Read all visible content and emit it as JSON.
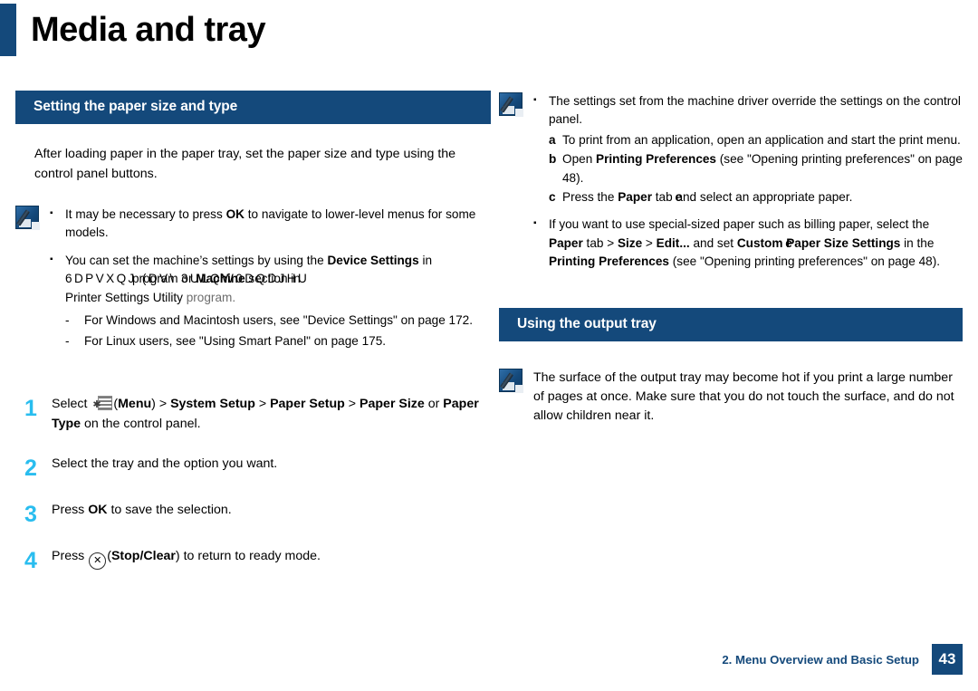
{
  "page": {
    "title": "Media and tray",
    "accent_color": "#14497b",
    "step_number_color": "#29bdef"
  },
  "left": {
    "section_title": "Setting the paper size and type",
    "intro": "After loading paper in the paper tray, set the paper size and type using the control panel buttons.",
    "note": {
      "icon": "note-pencil-icon",
      "bullets": [
        {
          "pre": "It may be necessary to press ",
          "bold": "OK",
          "post": " to navigate to lower-level menus for some models."
        },
        {
          "pre": "You can set the machine’s settings by using the ",
          "bold": "Device Settings",
          "post": " in ",
          "overlap_back": "6DPVXQJ (DV\\ 3ULQW0DQDJHU",
          "overlap_front_1": "program or ",
          "overlap_front_bold": "Machine",
          "overlap_front_2": " section in",
          "tail_pre": "Printer Settings Utility ",
          "tail_grey": "program."
        }
      ],
      "dash_items": [
        "For Windows and Macintosh users, see \"Device Settings\" on page 172.",
        "For Linux users, see \"Using Smart Panel\" on page 175."
      ]
    },
    "steps": [
      {
        "number": "1",
        "seg1": "Select ",
        "icon": "menu-icon",
        "seg2": "(",
        "bold1": "Menu",
        "seg3": ") > ",
        "bold2": "System Setup",
        "seg4": " > ",
        "bold3": "Paper Setup",
        "seg5": " > ",
        "bold4": "Paper Size",
        "seg6": " or ",
        "bold5": "Paper Type",
        "seg7": " on the control panel."
      },
      {
        "number": "2",
        "text": "Select the tray and the option you want."
      },
      {
        "number": "3",
        "seg1": "Press ",
        "bold1": "OK",
        "seg2": " to save the selection."
      },
      {
        "number": "4",
        "seg1": "Press ",
        "icon": "stop-clear-icon",
        "icon_glyph": "✕",
        "seg2": "(",
        "bold1": "Stop/Clear",
        "seg3": ") to return to ready mode."
      }
    ]
  },
  "right": {
    "note_top": {
      "icon": "note-pencil-icon",
      "bullet1": "The settings set from the machine driver override the settings on the control panel.",
      "alpha": [
        {
          "mark": "a",
          "text": "To print from an application, open an application and start the print menu."
        },
        {
          "mark": "b",
          "pre": "Open ",
          "bold": "Printing Preferences",
          "post": " (see \"Opening printing preferences\" on page 48)."
        },
        {
          "mark": "c",
          "pre": "Press the ",
          "bold": "Paper",
          "post": " tab ",
          "overlap_glyph": "e",
          "post2": "and select an appropriate paper."
        }
      ],
      "bullet2": {
        "line1": "If you want to use special-sized paper such as billing paper, select the",
        "b1": "Paper",
        "t1": " tab > ",
        "b2": "Size",
        "t2": " > ",
        "b3": "Edit...",
        "t3": " and set ",
        "b4_a": "Custom ",
        "overlap_glyph": "e",
        "b4_b": "Paper Size Settings",
        "t4": " in the",
        "b5": "Printing Preferences",
        "t5": " (see \"Opening printing preferences\" on page 48)."
      }
    },
    "section_title": "Using the output tray",
    "note_bottom": {
      "icon": "note-pencil-icon",
      "text": "The surface of the output tray may become hot if you print a large number of pages at once. Make sure that you do not touch the surface, and do not allow children near it."
    }
  },
  "footer": {
    "chapter": "2.  Menu Overview and Basic Setup",
    "page_number": "43"
  }
}
